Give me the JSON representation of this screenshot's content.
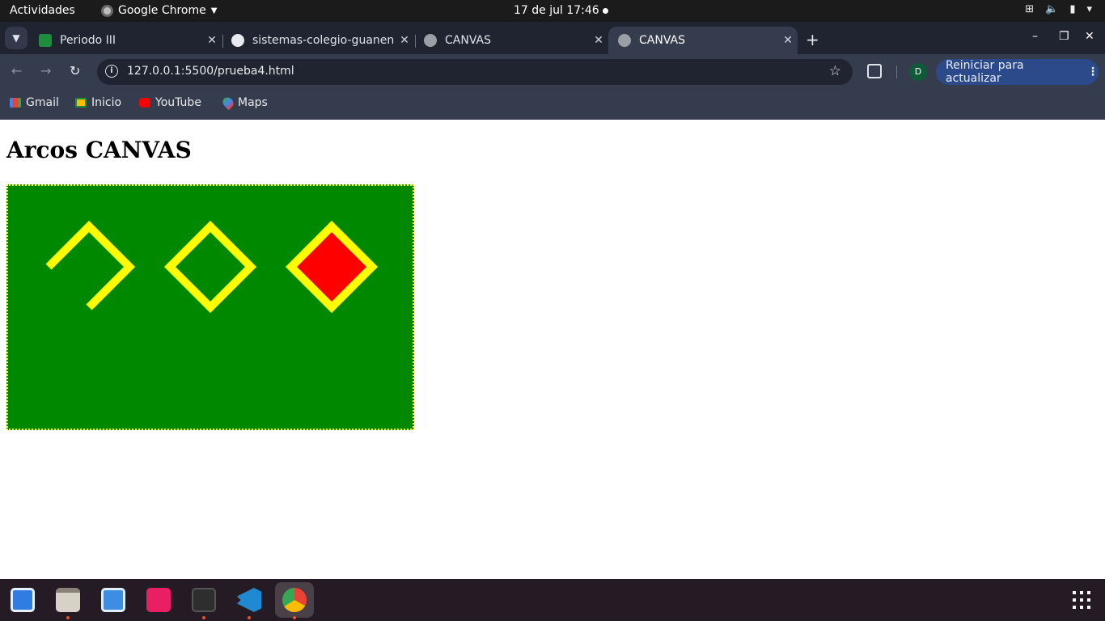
{
  "topbar": {
    "activities": "Actividades",
    "app_name": "Google Chrome",
    "clock": "17 de jul  17:46"
  },
  "tabs": [
    {
      "label": "Periodo III",
      "favicon": "google-classroom-icon",
      "active": false
    },
    {
      "label": "sistemas-colegio-guanen",
      "favicon": "github-icon",
      "active": false
    },
    {
      "label": "CANVAS",
      "favicon": "globe-icon",
      "active": false
    },
    {
      "label": "CANVAS",
      "favicon": "globe-icon",
      "active": true
    }
  ],
  "toolbar": {
    "url": "127.0.0.1:5500/prueba4.html",
    "profile_initial": "D",
    "update_label": "Reiniciar para actualizar"
  },
  "bookmarks": [
    {
      "label": "Gmail",
      "icon": "gmail-icon"
    },
    {
      "label": "Inicio",
      "icon": "google-classroom-icon"
    },
    {
      "label": "YouTube",
      "icon": "youtube-icon"
    },
    {
      "label": "Maps",
      "icon": "google-maps-icon"
    }
  ],
  "page": {
    "heading": "Arcos CANVAS",
    "canvas": {
      "background": "#008800",
      "border": "#ffff00",
      "shapes": [
        {
          "kind": "open-diamond-path",
          "stroke": "#ffff00",
          "fill": "none"
        },
        {
          "kind": "diamond",
          "stroke": "#ffff00",
          "fill": "none"
        },
        {
          "kind": "diamond",
          "stroke": "#ffff00",
          "fill": "#ff0000"
        }
      ]
    }
  },
  "dock": [
    {
      "name": "text-editor-icon",
      "running": false
    },
    {
      "name": "files-icon",
      "running": true
    },
    {
      "name": "system-monitor-icon",
      "running": false
    },
    {
      "name": "image-crop-icon",
      "running": false
    },
    {
      "name": "terminal-icon",
      "running": true
    },
    {
      "name": "vscode-icon",
      "running": true
    },
    {
      "name": "chrome-icon",
      "running": true,
      "active": true
    }
  ]
}
